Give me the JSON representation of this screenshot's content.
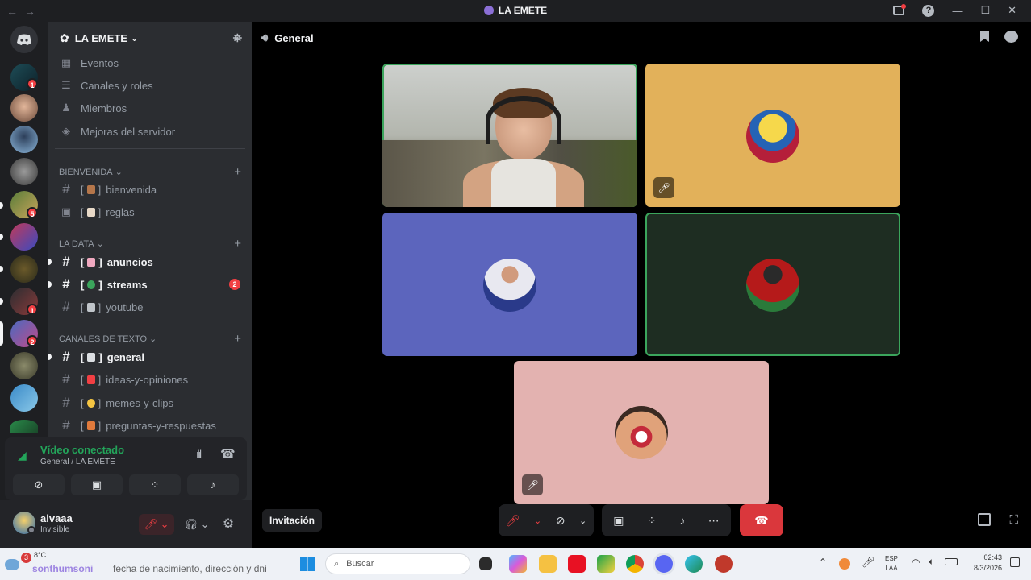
{
  "window": {
    "title": "LA EMETE",
    "back": "←",
    "forward": "→"
  },
  "titlebar_icons": [
    "inbox-icon",
    "help-icon",
    "minimize-icon",
    "maximize-icon",
    "close-icon"
  ],
  "guild": {
    "name": "LA EMETE",
    "chevron": "⌄"
  },
  "server_list": {
    "badges": [
      "1",
      "5",
      "1",
      "2"
    ]
  },
  "sidebar": {
    "menu": [
      "Eventos",
      "Canales y roles",
      "Miembros",
      "Mejoras del servidor"
    ],
    "categories": [
      {
        "name": "BIENVENIDA",
        "channels": [
          {
            "bracket_open": "[",
            "bracket_close": "]",
            "name": "bienvenida",
            "emoji_color": "#b5764a",
            "bold": false
          },
          {
            "bracket_open": "[",
            "bracket_close": "]",
            "name": "reglas",
            "emoji_color": "#e8d9c8",
            "bold": false
          }
        ]
      },
      {
        "name": "LA DATA",
        "channels": [
          {
            "bracket_open": "[",
            "bracket_close": "]",
            "name": "anuncios",
            "emoji_color": "#f0a9c0",
            "bold": true
          },
          {
            "bracket_open": "[",
            "bracket_close": "]",
            "name": "streams",
            "emoji_color": "#3ba55c",
            "bold": true,
            "badge": "2"
          },
          {
            "bracket_open": "[",
            "bracket_close": "]",
            "name": "youtube",
            "emoji_color": "#bfc4c9",
            "bold": false
          }
        ]
      },
      {
        "name": "CANALES DE TEXTO",
        "channels": [
          {
            "bracket_open": "[",
            "bracket_close": "]",
            "name": "general",
            "emoji_color": "#dbdee1",
            "bold": true
          },
          {
            "bracket_open": "[",
            "bracket_close": "]",
            "name": "ideas-y-opiniones",
            "emoji_color": "#f23f43",
            "bold": false
          },
          {
            "bracket_open": "[",
            "bracket_close": "]",
            "name": "memes-y-clips",
            "emoji_color": "#f5c542",
            "bold": false
          },
          {
            "bracket_open": "[",
            "bracket_close": "]",
            "name": "preguntas-y-respuestas",
            "emoji_color": "#e07a3c",
            "bold": false
          }
        ]
      }
    ]
  },
  "voice": {
    "status": "Vídeo conectado",
    "location": "General / LA EMETE"
  },
  "user": {
    "name": "alvaaa",
    "status": "Invisible"
  },
  "channel_header": {
    "name": "General"
  },
  "invite_label": "Invitación",
  "tiles": [
    {
      "kind": "camera",
      "speaking": true
    },
    {
      "kind": "avatar",
      "bg": "#e2b15a",
      "muted": true,
      "speaking": false
    },
    {
      "kind": "avatar",
      "bg": "#5c65bd",
      "muted": false,
      "speaking": false
    },
    {
      "kind": "avatar",
      "bg": "#1e2d22",
      "muted": false,
      "speaking": true
    },
    {
      "kind": "avatar",
      "bg": "#e3b2b0",
      "muted": true,
      "speaking": false
    }
  ],
  "colors": {
    "accent_green": "#23a55a",
    "hangup": "#da373c",
    "mute_red": "#f23f43"
  },
  "taskbar": {
    "weather_badge": "3",
    "temperature": "8°C",
    "news_ticker": "fecha de nacimiento, dirección y dni",
    "ticker_prefix": "sonthumsoni",
    "search_placeholder": "Buscar",
    "lang_top": "ESP",
    "lang_bottom": "LAA",
    "time": "02:43",
    "date": "8/3/2026"
  }
}
